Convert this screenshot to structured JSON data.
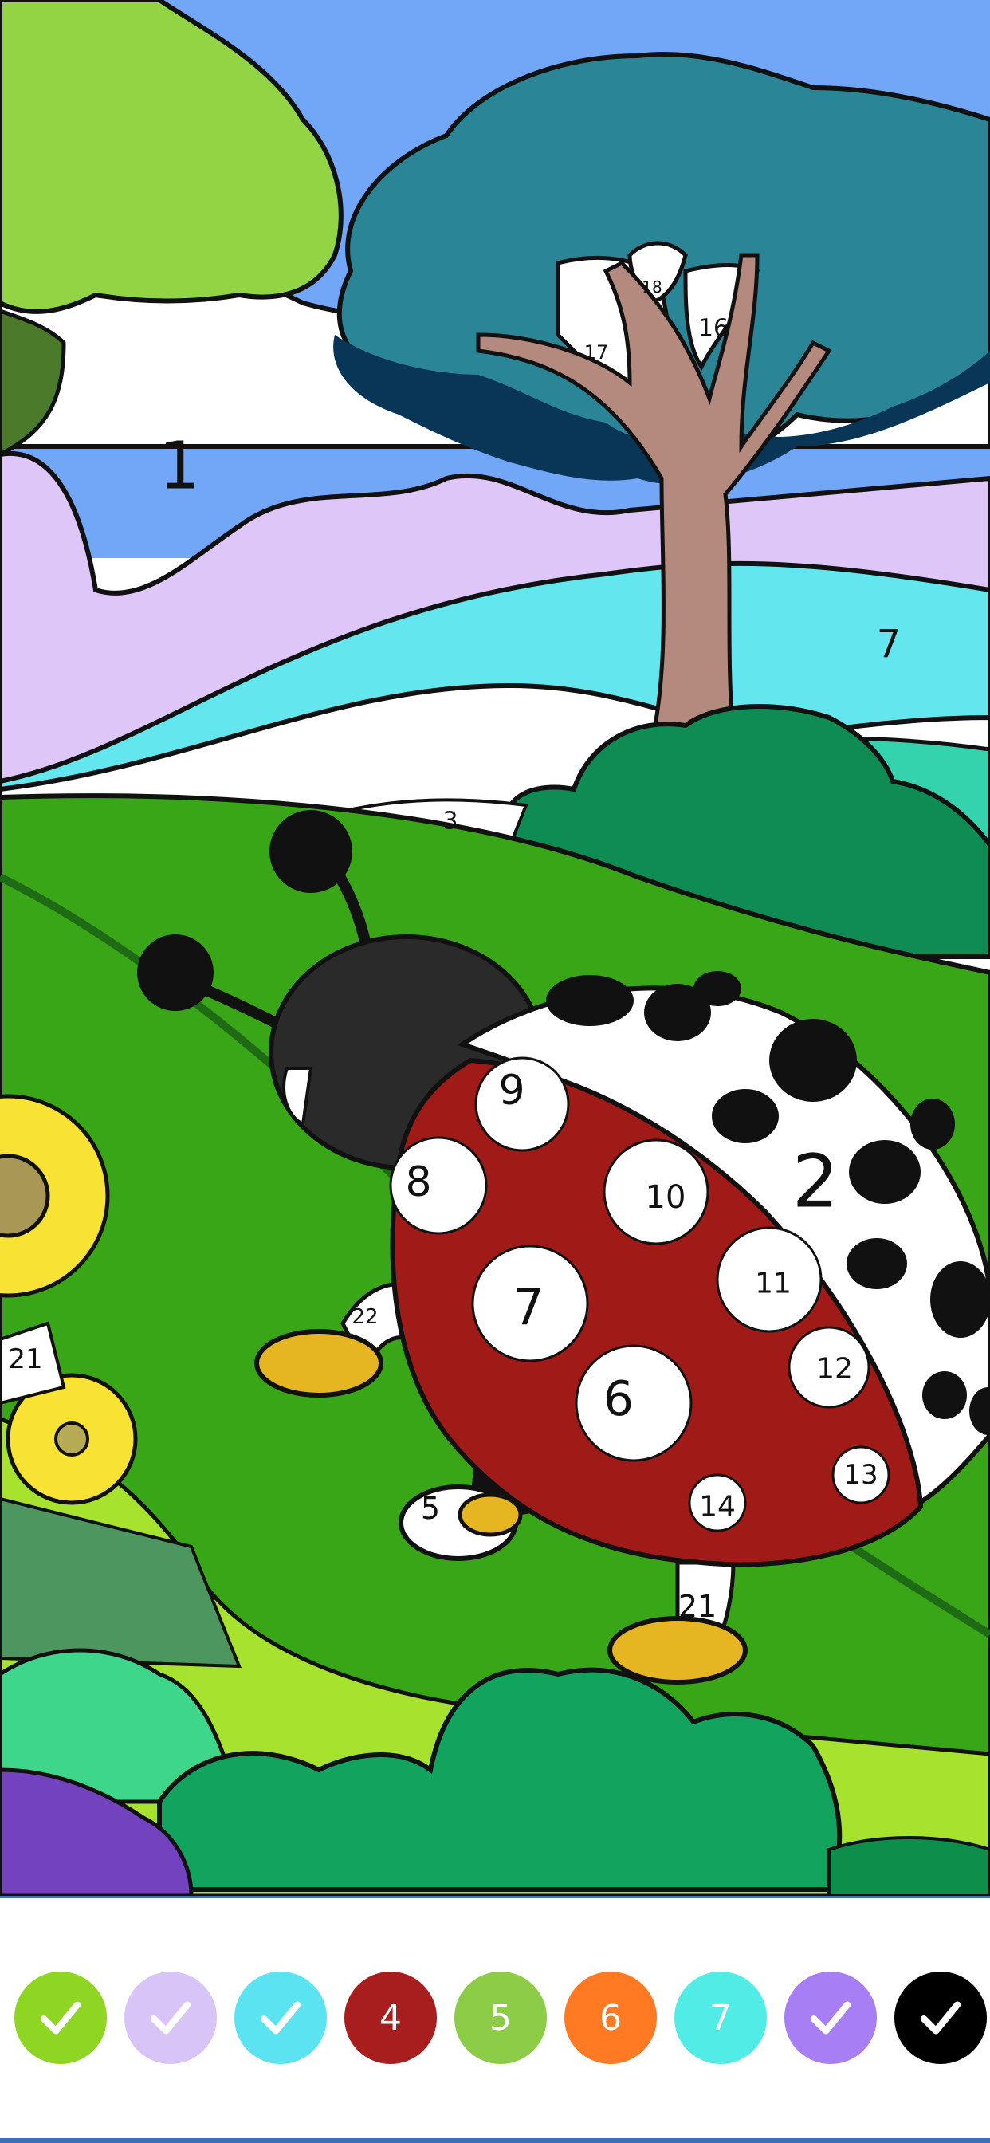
{
  "regions": {
    "sky_big": "1",
    "bug_wing": "2",
    "path": "3",
    "hill": "7",
    "spot_6": "6",
    "spot_7": "7",
    "spot_8": "8",
    "spot_9": "9",
    "spot_10": "10",
    "spot_11": "11",
    "spot_12": "12",
    "spot_13": "13",
    "spot_14": "14",
    "leg_5": "5",
    "leg_21": "21",
    "leg_22": "22",
    "flower_21": "21",
    "branch_16": "16",
    "branch_17": "17",
    "branch_18": "18"
  },
  "palette": [
    {
      "label": "",
      "color": "#8fd523",
      "completed": true
    },
    {
      "label": "",
      "color": "#d8c4f7",
      "completed": true
    },
    {
      "label": "",
      "color": "#5ce3f2",
      "completed": true
    },
    {
      "label": "4",
      "color": "#a81e1e",
      "completed": false
    },
    {
      "label": "5",
      "color": "#8dcc47",
      "completed": false
    },
    {
      "label": "6",
      "color": "#ff7a22",
      "completed": false
    },
    {
      "label": "7",
      "color": "#52ece6",
      "completed": false
    },
    {
      "label": "",
      "color": "#a77ef4",
      "completed": true
    },
    {
      "label": "",
      "color": "#000000",
      "completed": true
    }
  ]
}
